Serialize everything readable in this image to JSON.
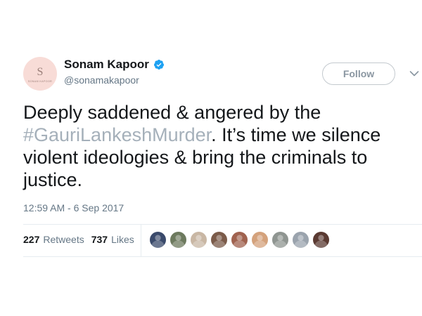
{
  "user": {
    "avatar_letter": "S",
    "avatar_caption": "Sonam Kapoor",
    "display_name": "Sonam Kapoor",
    "verified": true,
    "handle": "@sonamakapoor"
  },
  "follow_button": {
    "label": "Follow"
  },
  "tweet": {
    "text_before": "Deeply saddened & angered by the ",
    "hashtag": "#GauriLankeshMurder",
    "text_after": ". It’s time we silence violent ideologies & bring the criminals to justice.",
    "timestamp": "12:59 AM - 6 Sep 2017"
  },
  "stats": {
    "retweets_count": "227",
    "retweets_label": "Retweets",
    "likes_count": "737",
    "likes_label": "Likes"
  },
  "likers": [
    {
      "name": "liker-avatar-1",
      "color": "#3a4a6b"
    },
    {
      "name": "liker-avatar-2",
      "color": "#6d7a5e"
    },
    {
      "name": "liker-avatar-3",
      "color": "#c9b7a4"
    },
    {
      "name": "liker-avatar-4",
      "color": "#7b5b4a"
    },
    {
      "name": "liker-avatar-5",
      "color": "#a0624f"
    },
    {
      "name": "liker-avatar-6",
      "color": "#d4a27c"
    },
    {
      "name": "liker-avatar-7",
      "color": "#8f9591"
    },
    {
      "name": "liker-avatar-8",
      "color": "#9aa3ad"
    },
    {
      "name": "liker-avatar-9",
      "color": "#5a3a32"
    }
  ],
  "colors": {
    "verified_badge": "#1da1f2",
    "hashtag": "#a5b0ba",
    "secondary_text": "#657786",
    "avatar_bg": "#f8dcd7"
  }
}
